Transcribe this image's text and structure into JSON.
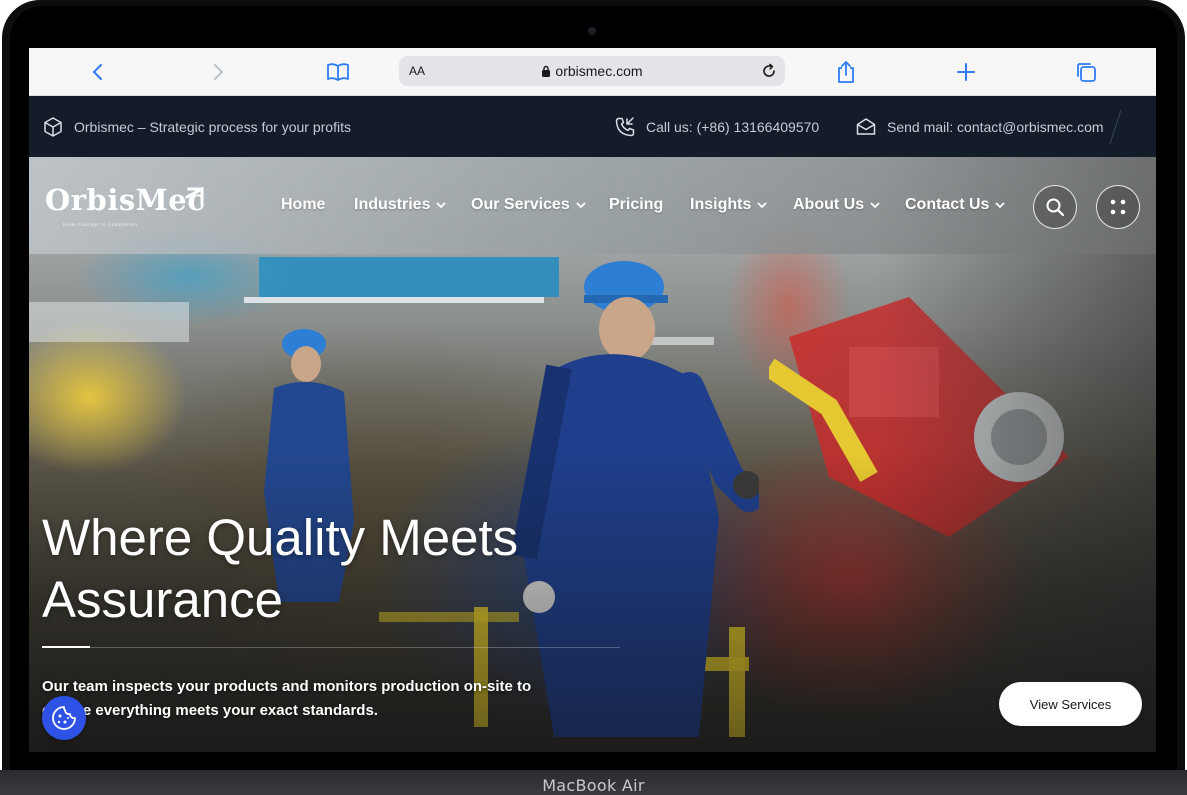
{
  "device": {
    "model_label": "MacBook Air"
  },
  "browser": {
    "text_size_label": "AA",
    "url": "orbismec.com",
    "icons": [
      "back-icon",
      "forward-icon",
      "bookmarks-icon",
      "lock-icon",
      "reload-icon",
      "share-icon",
      "new-tab-icon",
      "tabs-icon"
    ]
  },
  "topbar": {
    "tagline": "Orbismec – Strategic process for your profits",
    "phone": "Call us: (+86) 13166409570",
    "email": "Send mail: contact@orbismec.com"
  },
  "brand": {
    "name": "OrbisMec",
    "subline": "From Concept to Completion"
  },
  "nav": {
    "items": [
      {
        "label": "Home",
        "has_dropdown": false
      },
      {
        "label": "Industries",
        "has_dropdown": true
      },
      {
        "label": "Our Services",
        "has_dropdown": true
      },
      {
        "label": "Pricing",
        "has_dropdown": false
      },
      {
        "label": "Insights",
        "has_dropdown": true
      },
      {
        "label": "About Us",
        "has_dropdown": true
      },
      {
        "label": "Contact Us",
        "has_dropdown": true
      }
    ]
  },
  "hero": {
    "title_line1": "Where Quality Meets",
    "title_line2": "Assurance",
    "description": "Our team inspects your products and monitors production on-site to ensure everything meets your exact standards.",
    "cta_label": "View Services"
  },
  "colors": {
    "topbar_bg": "#131c28",
    "cookie_button": "#2f52e6",
    "cta_bg": "#ffffff"
  }
}
